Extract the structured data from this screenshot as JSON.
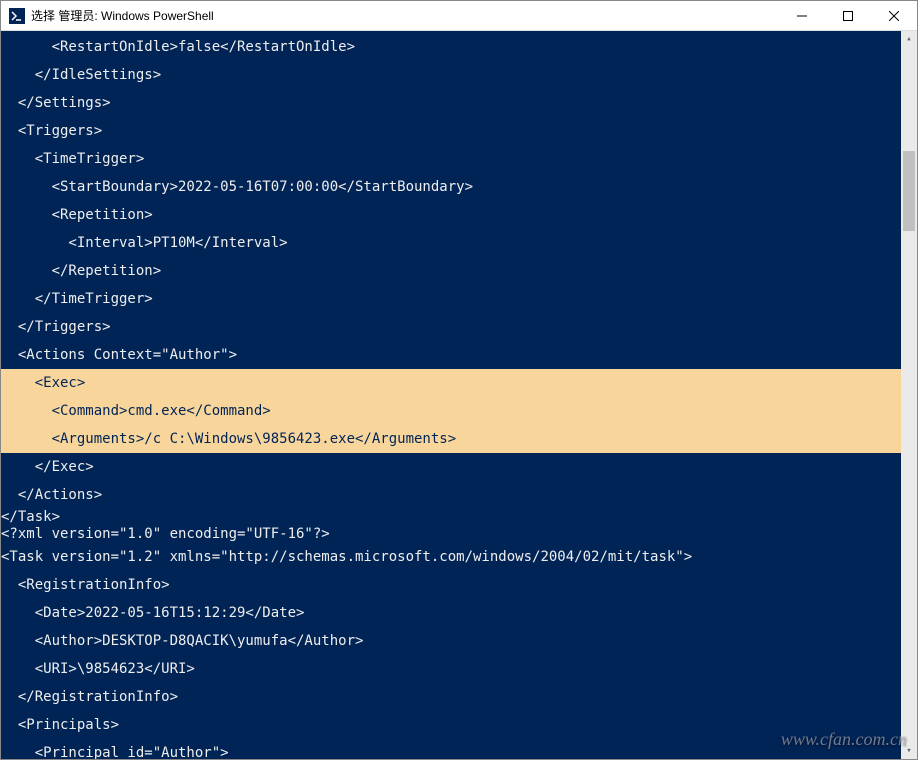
{
  "titlebar": {
    "title": "选择 管理员: Windows PowerShell"
  },
  "controls": {
    "min": "minimize",
    "max": "maximize",
    "close": "close"
  },
  "watermark": "www.cfan.com.cn",
  "lines": {
    "l0": "      <RestartOnIdle>false</RestartOnIdle>",
    "l1": "    </IdleSettings>",
    "l2": "  </Settings>",
    "l3": "  <Triggers>",
    "l4": "    <TimeTrigger>",
    "l5": "      <StartBoundary>2022-05-16T07:00:00</StartBoundary>",
    "l6": "      <Repetition>",
    "l7": "        <Interval>PT10M</Interval>",
    "l8": "      </Repetition>",
    "l9": "    </TimeTrigger>",
    "l10": "  </Triggers>",
    "l11": "  <Actions Context=\"Author\">",
    "l12": "    <Exec>",
    "l13": "      <Command>cmd.exe</Command>",
    "l14": "      <Arguments>/c C:\\Windows\\9856423.exe</Arguments>",
    "l15": "    </Exec>",
    "l16": "  </Actions>",
    "l17": "</Task>",
    "l18": "<?xml version=\"1.0\" encoding=\"UTF-16\"?>",
    "l19": "",
    "l20": "<Task version=\"1.2\" xmlns=\"http://schemas.microsoft.com/windows/2004/02/mit/task\">",
    "l21": "  <RegistrationInfo>",
    "l22": "    <Date>2022-05-16T15:12:29</Date>",
    "l23": "    <Author>DESKTOP-D8QACIK\\yumufa</Author>",
    "l24": "    <URI>\\9854623</URI>",
    "l25": "  </RegistrationInfo>",
    "l26": "  <Principals>",
    "l27": "    <Principal id=\"Author\">"
  }
}
